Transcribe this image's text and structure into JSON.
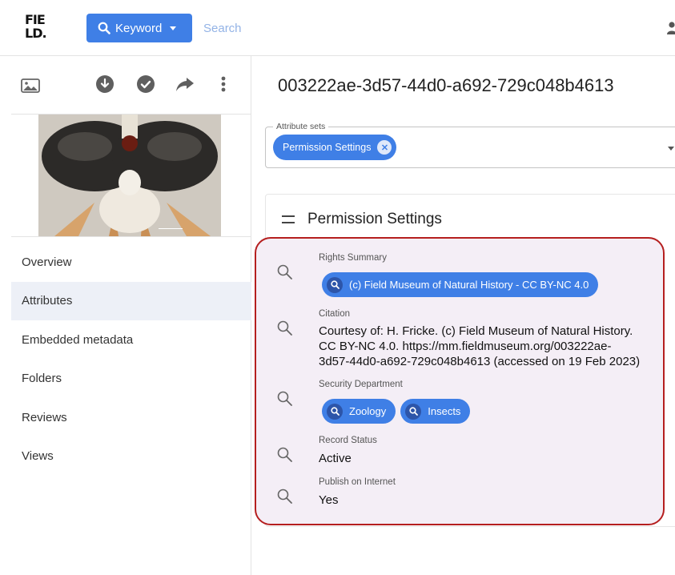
{
  "header": {
    "logo_lines": [
      "FIE",
      "LD."
    ],
    "keyword_label": "Keyword",
    "search_placeholder": "Search"
  },
  "sidebar": {
    "nav": [
      {
        "label": "Overview"
      },
      {
        "label": "Attributes"
      },
      {
        "label": "Embedded metadata"
      },
      {
        "label": "Folders"
      },
      {
        "label": "Reviews"
      },
      {
        "label": "Views"
      }
    ],
    "active_index": 1
  },
  "main": {
    "asset_title": "003222ae-3d57-44d0-a692-729c048b4613",
    "attribute_sets": {
      "legend": "Attribute sets",
      "chip": "Permission Settings"
    },
    "panel": {
      "title": "Permission Settings",
      "fields": {
        "rights_summary": {
          "label": "Rights Summary",
          "tags": [
            "(c) Field Museum of Natural History - CC BY-NC 4.0"
          ]
        },
        "citation": {
          "label": "Citation",
          "value_lines": [
            "Courtesy of: H. Fricke. (c) Field Museum of Natural History.",
            "CC BY-NC 4.0. https://mm.fieldmuseum.org/003222ae-",
            "3d57-44d0-a692-729c048b4613 (accessed on 19 Feb 2023)"
          ]
        },
        "security_department": {
          "label": "Security Department",
          "tags": [
            "Zoology",
            "Insects"
          ]
        },
        "record_status": {
          "label": "Record Status",
          "value": "Active"
        },
        "publish_on_internet": {
          "label": "Publish on Internet",
          "value": "Yes"
        }
      }
    }
  },
  "colors": {
    "accent": "#3f7fe6",
    "highlight_border": "#b51f1f",
    "highlight_fill": "#f4eef6",
    "active_nav": "#edf0f7"
  }
}
